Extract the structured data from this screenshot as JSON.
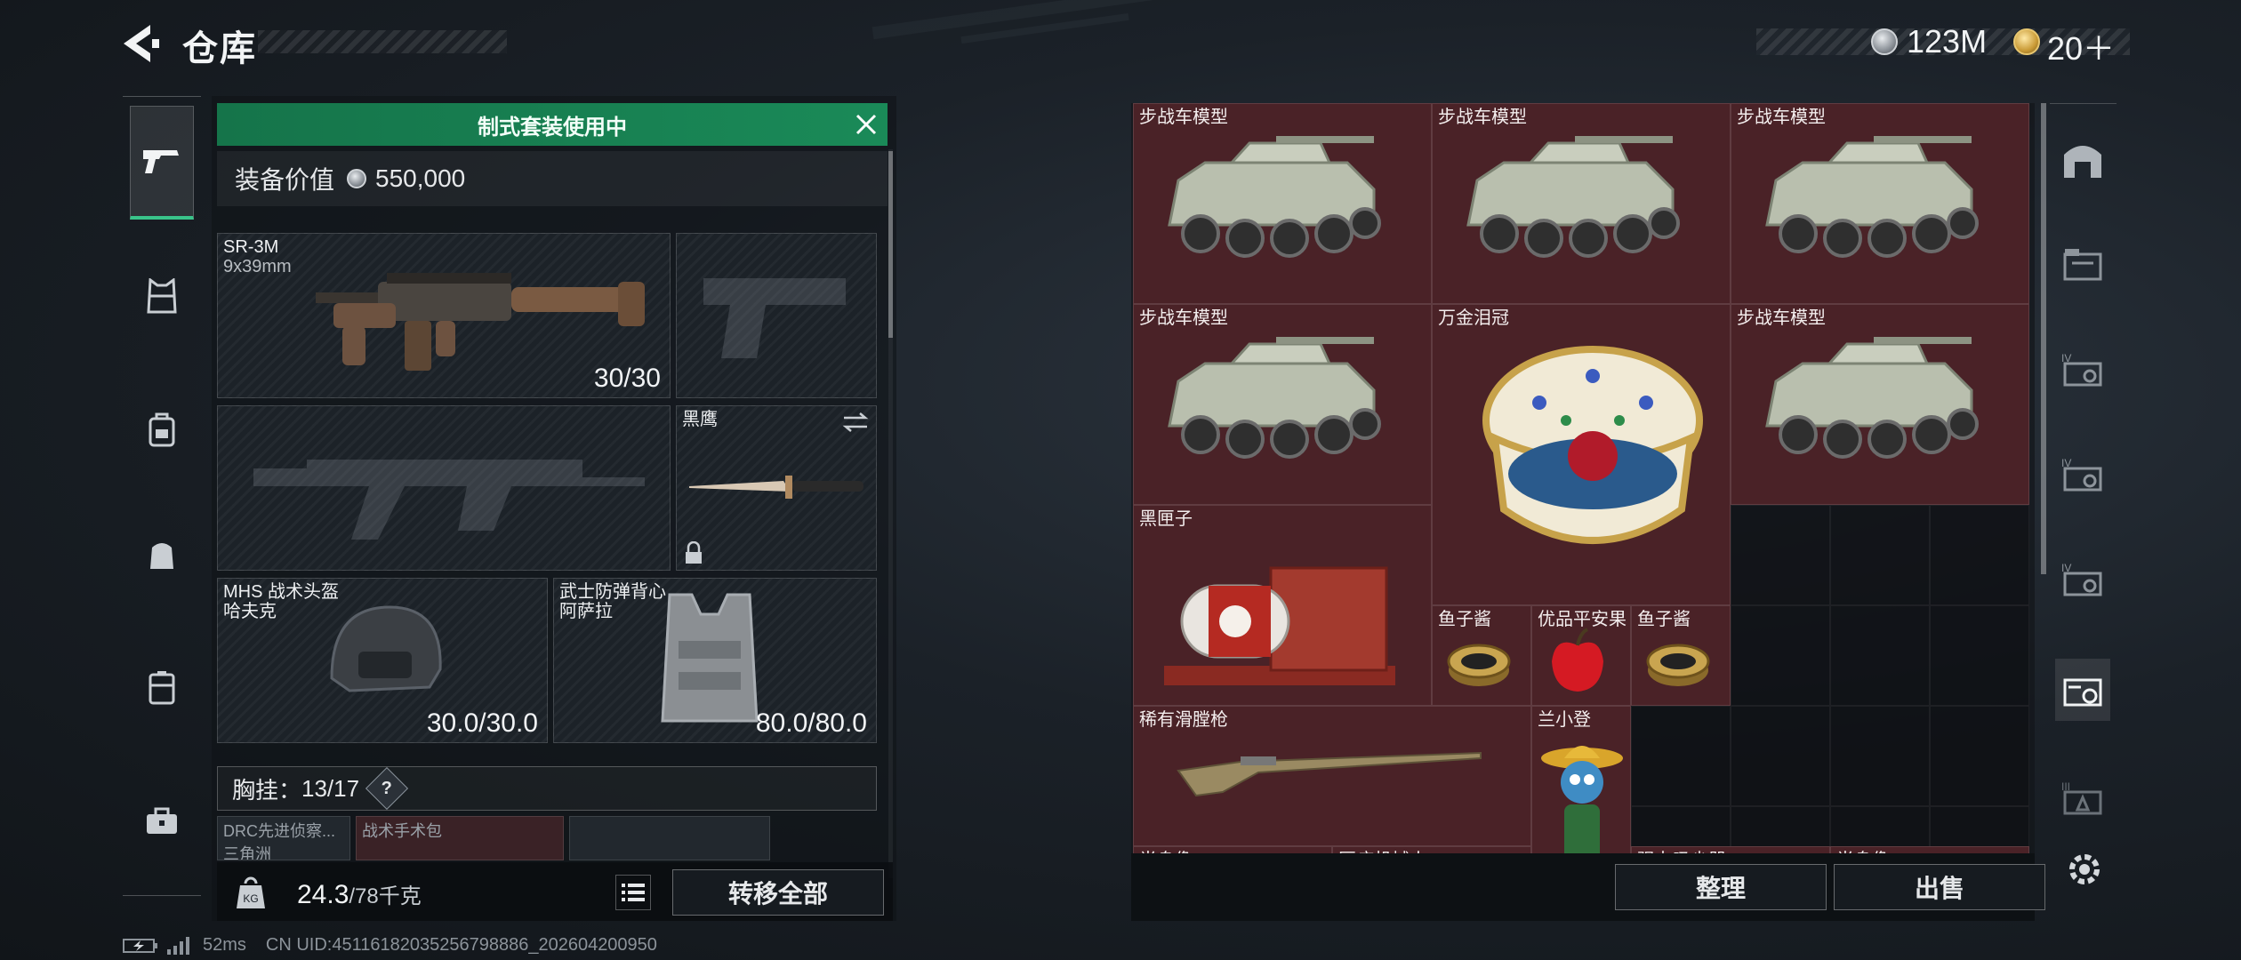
{
  "header": {
    "title": "仓库"
  },
  "currency": [
    {
      "icon": "silver-coin-icon",
      "value": "123M"
    },
    {
      "icon": "gold-coin-icon",
      "value": "20＋"
    }
  ],
  "loadout": {
    "banner": "制式套装使用中",
    "value_label": "装备价值",
    "value": "550,000",
    "primary_weapon": {
      "name": "SR-3M",
      "caliber": "9x39mm",
      "ammo": "30/30"
    },
    "melee": {
      "name": "黑鹰"
    },
    "helmet": {
      "name": "MHS 战术头盔",
      "sub": "哈夫克",
      "durability": "30.0/30.0"
    },
    "armor": {
      "name": "武士防弹背心",
      "sub": "阿萨拉",
      "durability": "80.0/80.0"
    },
    "chest_rig": {
      "label": "胸挂：",
      "capacity": "13/17",
      "help": "?"
    },
    "mini_slots": [
      "DRC先进侦察...",
      "战术手术包",
      ""
    ],
    "mini_sub": "三角洲",
    "weight": {
      "value": "24.3",
      "max": "/78千克"
    },
    "transfer_all": "转移全部"
  },
  "storage": {
    "items": [
      {
        "name": "步战车模型",
        "kind": "ifv"
      },
      {
        "name": "步战车模型",
        "kind": "ifv"
      },
      {
        "name": "步战车模型",
        "kind": "ifv"
      },
      {
        "name": "步战车模型",
        "kind": "ifv"
      },
      {
        "name": "万金泪冠",
        "kind": "egg"
      },
      {
        "name": "步战车模型",
        "kind": "ifv"
      },
      {
        "name": "黑匣子",
        "kind": "blackbox"
      },
      {
        "name": "鱼子酱",
        "kind": "caviar"
      },
      {
        "name": "优品平安果",
        "kind": "apple"
      },
      {
        "name": "鱼子酱",
        "kind": "caviar"
      },
      {
        "name": "稀有滑膛枪",
        "kind": "musket"
      },
      {
        "name": "兰小登",
        "kind": "figure"
      },
      {
        "name": "半身像",
        "kind": "bust"
      },
      {
        "name": "医疗机械人",
        "kind": "robot"
      },
      {
        "name": "强力吸尘器",
        "kind": "vacuum"
      },
      {
        "name": "半身像",
        "kind": "bust"
      }
    ],
    "sort_label": "整理",
    "sell_label": "出售"
  },
  "status_bar": {
    "ping": "52ms",
    "uid": "CN UID:45116182035256798886_202604200950"
  },
  "colors": {
    "accent_green": "#1a8a58",
    "item_bg": "#4a2227"
  }
}
